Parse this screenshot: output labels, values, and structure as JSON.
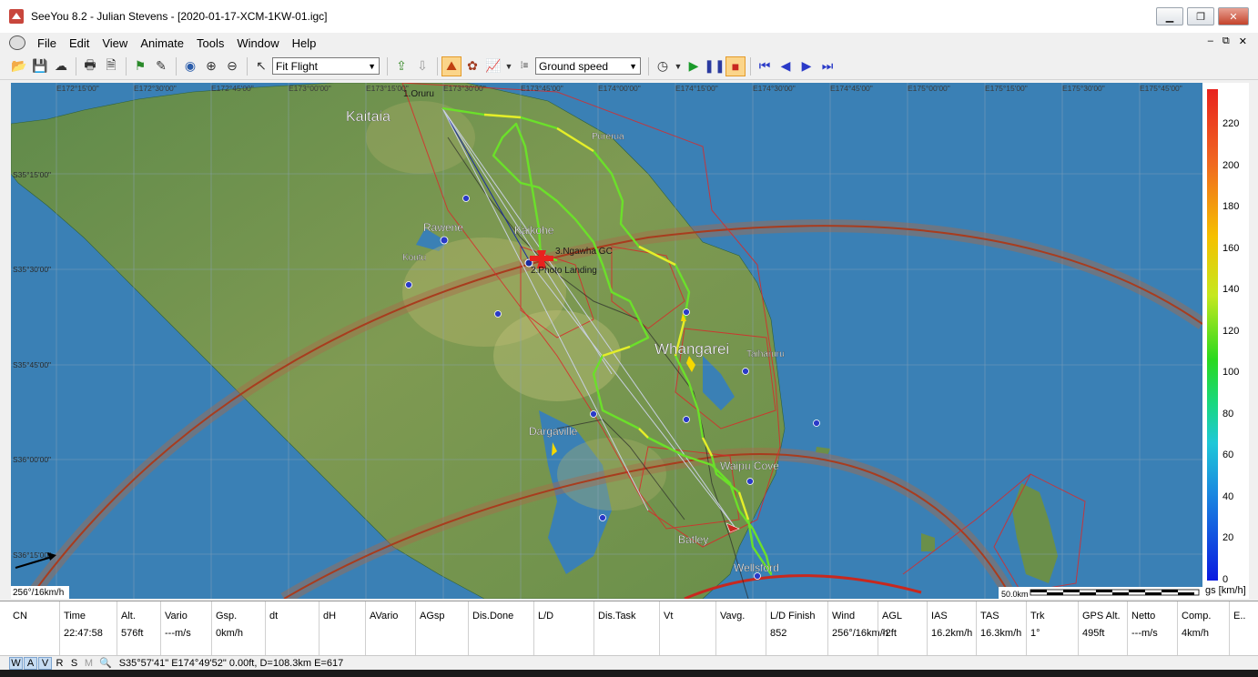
{
  "window": {
    "title": "SeeYou 8.2 - Julian Stevens - [2020-01-17-XCM-1KW-01.igc]",
    "minimize_icon": "minimize-icon",
    "restore_icon": "restore-icon",
    "close_icon": "close-icon"
  },
  "menu": {
    "items": [
      "File",
      "Edit",
      "View",
      "Animate",
      "Tools",
      "Window",
      "Help"
    ],
    "mdi": [
      "‒",
      "⧉",
      "✕"
    ]
  },
  "toolbar": {
    "fit_select": "Fit Flight",
    "color_select": "Ground speed"
  },
  "map": {
    "lon_labels": [
      "E172°15'00\"",
      "E172°30'00\"",
      "E172°45'00\"",
      "E173°00'00\"",
      "E173°15'00\"",
      "E173°30'00\"",
      "E173°45'00\"",
      "E174°00'00\"",
      "E174°15'00\"",
      "E174°30'00\"",
      "E174°45'00\"",
      "E175°00'00\"",
      "E175°15'00\"",
      "E175°30'00\"",
      "E175°45'00\""
    ],
    "lat_labels": [
      "S35°15'00\"",
      "S35°30'00\"",
      "S35°45'00\"",
      "S36°00'00\"",
      "S36°15'00\""
    ],
    "places": {
      "kaitaia": "Kaitaia",
      "purerua": "Purerua",
      "rawene": "Rawene",
      "kaikohe": "Kaikohe",
      "koutu": "Koutu",
      "whangarei": "Whangarei",
      "taiharuru": "Taiharuru",
      "dargaville": "Dargaville",
      "waipu_cove": "Waipu Cove",
      "batley": "Batley",
      "wellsford": "Wellsford"
    },
    "waypoints": {
      "wp1": "1.Oruru",
      "wp2": "2.Photo Landing",
      "wp3": "3.Ngawha GC"
    },
    "wind": "256°/16km/h",
    "scale": "50.0km"
  },
  "colorbar": {
    "labels": [
      "220",
      "200",
      "180",
      "160",
      "140",
      "120",
      "100",
      "80",
      "60",
      "40",
      "20",
      "0"
    ],
    "unit": "gs [km/h]"
  },
  "status": {
    "headers": [
      "CN",
      "Time",
      "Alt.",
      "Vario",
      "Gsp.",
      "dt",
      "dH",
      "AVario",
      "AGsp",
      "Dis.Done",
      "L/D",
      "Dis.Task",
      "Vt",
      "Vavg.",
      "L/D Finish",
      "Wind",
      "AGL",
      "IAS",
      "TAS",
      "Trk",
      "GPS Alt.",
      "Netto",
      "Comp.",
      "E.."
    ],
    "values": [
      "",
      "22:47:58",
      "576ft",
      "---m/s",
      "0km/h",
      "",
      "",
      "",
      "",
      "",
      "",
      "",
      "",
      "",
      "852",
      "256°/16km/h",
      "-2ft",
      "16.2km/h",
      "16.3km/h",
      "1°",
      "495ft",
      "---m/s",
      "4km/h",
      ""
    ]
  },
  "bottom": {
    "modes": [
      "W",
      "A",
      "V",
      "R",
      "S",
      "M"
    ],
    "coord": "S35°57'41\" E174°49'52\" 0.00ft, D=108.3km E=617"
  }
}
